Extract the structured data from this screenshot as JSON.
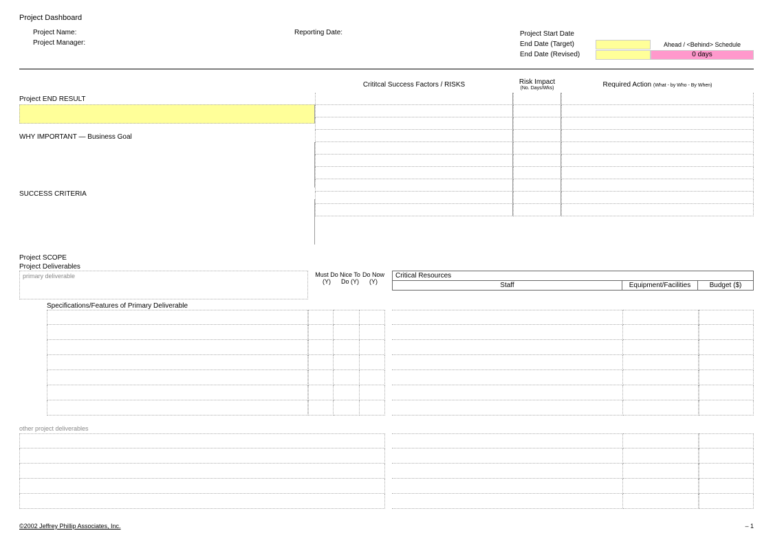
{
  "title": "Project Dashboard",
  "header": {
    "project_name_label": "Project Name:",
    "project_manager_label": "Project Manager:",
    "reporting_date_label": "Reporting Date:",
    "start_date_label": "Project Start Date",
    "end_date_target_label": "End Date (Target)",
    "end_date_revised_label": "End Date (Revised)",
    "schedule_label": "Ahead / <Behind> Schedule",
    "schedule_value": "0 days"
  },
  "section1": {
    "end_result_label": "Project END RESULT",
    "why_important_label": "WHY IMPORTANT — Business Goal",
    "success_criteria_label": "SUCCESS CRITERIA",
    "csf_header": "Crititcal Success Factors / RISKS",
    "risk_impact_header": "Risk Impact",
    "risk_impact_sub": "(No. Days/Wks)",
    "required_action_header": "Required Action",
    "required_action_sub": "(What - by Who - By When)"
  },
  "scope": {
    "scope_label": "Project SCOPE",
    "deliverables_label": "Project Deliverables",
    "primary_placeholder": "primary deliverable",
    "must_do": "Must Do (Y)",
    "nice_to_do": "Nice To Do (Y)",
    "do_now": "Do Now (Y)",
    "critical_resources": "Critical Resources",
    "staff": "Staff",
    "equipment": "Equipment/Facilities",
    "budget": "Budget ($)",
    "spec_title": "Specifications/Features of Primary Deliverable",
    "other_title": "other project deliverables"
  },
  "footer": {
    "copyright": "©2002 Jeffrey Phillip Associates, Inc.",
    "page": "– 1"
  }
}
